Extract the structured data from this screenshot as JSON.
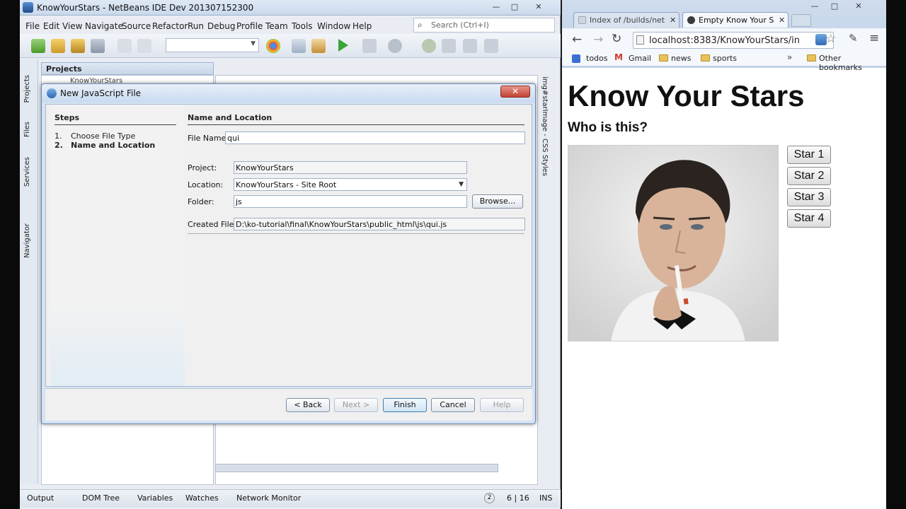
{
  "netbeans": {
    "title": "KnowYourStars - NetBeans IDE Dev 201307152300",
    "menu": [
      "File",
      "Edit",
      "View",
      "Navigate",
      "Source",
      "Refactor",
      "Run",
      "Debug",
      "Profile",
      "Team",
      "Tools",
      "Window",
      "Help"
    ],
    "search_placeholder": "Search (Ctrl+I)",
    "projects_tab": "Projects",
    "project_node": "KnowYourStars",
    "side_tabs": [
      "Projects",
      "Files",
      "Services",
      "Navigator"
    ],
    "right_tab": "img#starImage - CSS Styles",
    "status": {
      "output": "Output",
      "dom_tree": "DOM Tree",
      "variables": "Variables",
      "watches": "Watches",
      "network_monitor": "Network Monitor",
      "notifications": "2",
      "position": "6 | 16",
      "mode": "INS"
    }
  },
  "dialog": {
    "title": "New JavaScript File",
    "steps_title": "Steps",
    "steps": [
      {
        "num": "1.",
        "label": "Choose File Type"
      },
      {
        "num": "2.",
        "label": "Name and Location"
      }
    ],
    "panel_title": "Name and Location",
    "file_name_label": "File Name:",
    "file_name_value": "qui",
    "project_label": "Project:",
    "project_value": "KnowYourStars",
    "location_label": "Location:",
    "location_value": "KnowYourStars - Site Root",
    "folder_label": "Folder:",
    "folder_value": "js",
    "browse_label": "Browse...",
    "created_file_label": "Created File:",
    "created_file_value": "D:\\ko-tutorial\\final\\KnowYourStars\\public_html\\js\\qui.js",
    "buttons": {
      "back": "< Back",
      "next": "Next >",
      "finish": "Finish",
      "cancel": "Cancel",
      "help": "Help"
    }
  },
  "browser": {
    "tabs": [
      {
        "title": "Index of /builds/net",
        "active": false
      },
      {
        "title": "Empty Know Your S",
        "active": true
      }
    ],
    "url": "localhost:8383/KnowYourStars/in",
    "bookmarks": [
      "todos",
      "Gmail",
      "news",
      "sports"
    ],
    "other_bookmarks": "Other bookmarks",
    "page": {
      "heading": "Know Your Stars",
      "subheading": "Who is this?",
      "buttons": [
        "Star 1",
        "Star 2",
        "Star 3",
        "Star 4"
      ]
    }
  }
}
